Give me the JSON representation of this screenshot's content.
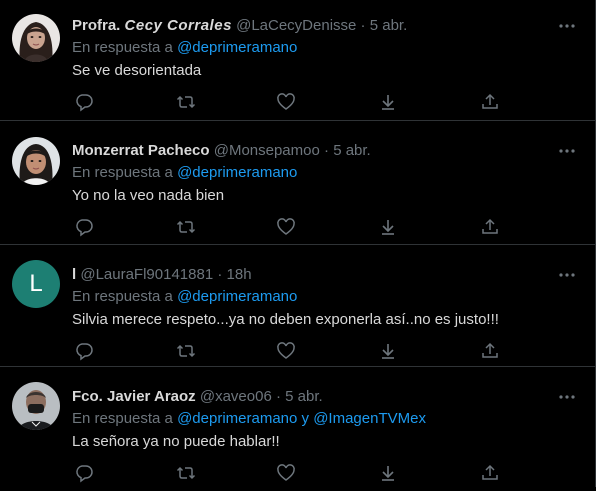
{
  "tweets": [
    {
      "name_plain": "Profra. ",
      "name_fancy": "Cecy Corrales",
      "handle": "@LaCecyDenisse",
      "sep": "·",
      "time": "5 abr.",
      "reply_prefix": "En respuesta a ",
      "mention": "@deprimeramano",
      "text": "Se ve desorientada"
    },
    {
      "name_plain": "Monzerrat Pacheco",
      "handle": "@Monsepamoo",
      "sep": "·",
      "time": "5 abr.",
      "reply_prefix": "En respuesta a ",
      "mention": "@deprimeramano",
      "text": "Yo no la veo nada bien"
    },
    {
      "name_plain": "l",
      "avatar_letter": "L",
      "handle": "@LauraFl90141881",
      "sep": "·",
      "time": "18h",
      "reply_prefix": "En respuesta a ",
      "mention": "@deprimeramano",
      "text": "Silvia merece respeto...ya no deben exponerla así..no es justo!!!"
    },
    {
      "name_plain": "Fco. Javier Araoz",
      "handle": "@xaveo06",
      "sep": "·",
      "time": "5 abr.",
      "reply_prefix": "En respuesta a ",
      "mention": "@deprimeramano",
      "mention_joiner": " y ",
      "mention2": "@ImagenTVMex",
      "text": "La señora ya no puede hablar!!"
    }
  ],
  "icons": {
    "more": "more-icon",
    "reply": "reply-icon",
    "retweet": "retweet-icon",
    "like": "like-icon",
    "download": "download-icon",
    "share": "share-icon"
  },
  "colors": {
    "background": "#000000",
    "text": "#d9d9d9",
    "muted": "#6e767d",
    "link": "#1d9bf0",
    "divider": "#2f3336",
    "avatar_l": "#1d7f73"
  }
}
